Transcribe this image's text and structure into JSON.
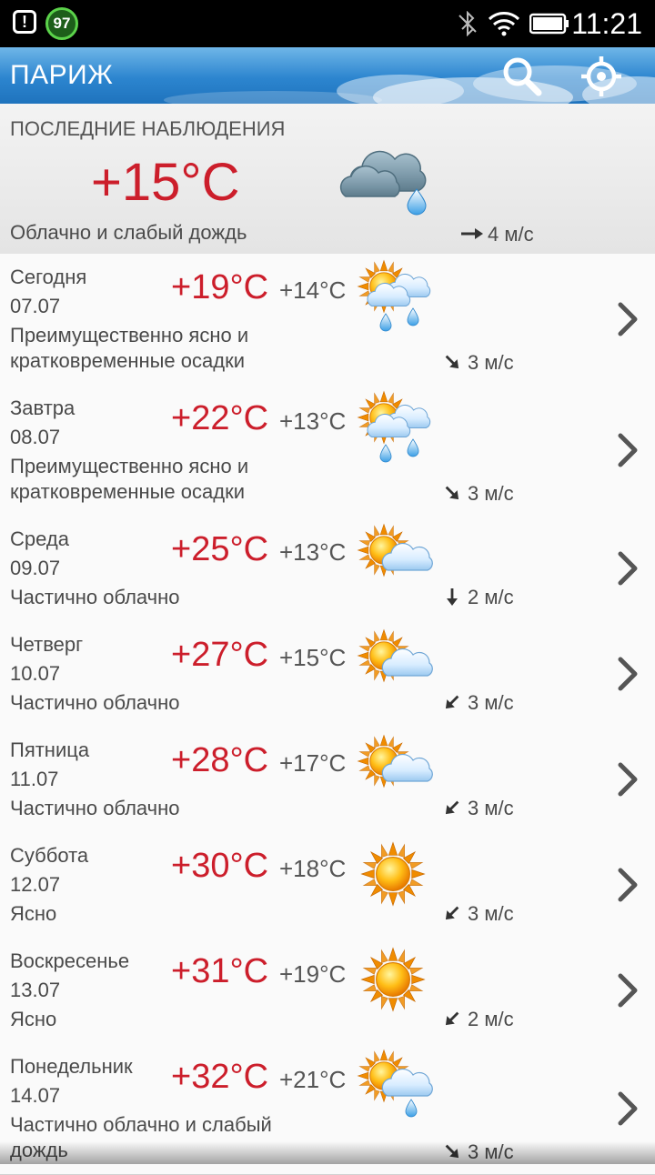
{
  "status": {
    "badge": "97",
    "time": "11:21"
  },
  "app": {
    "title": "ПАРИЖ"
  },
  "current": {
    "heading": "ПОСЛЕДНИЕ НАБЛЮДЕНИЯ",
    "temp": "+15°C",
    "desc": "Облачно и слабый дождь",
    "wind": "4 м/с",
    "icon": "cloud-rain-icon",
    "wind_dir": "east"
  },
  "days": [
    {
      "day": "Сегодня",
      "date": "07.07",
      "hi": "+19°C",
      "lo": "+14°C",
      "desc": "Преимущественно ясно и кратковременные осадки",
      "wind": "3 м/с",
      "icon": "sun-cloud-rain-icon",
      "wind_dir": "southeast"
    },
    {
      "day": "Завтра",
      "date": "08.07",
      "hi": "+22°C",
      "lo": "+13°C",
      "desc": "Преимущественно ясно и кратковременные осадки",
      "wind": "3 м/с",
      "icon": "sun-cloud-rain-icon",
      "wind_dir": "southeast"
    },
    {
      "day": "Среда",
      "date": "09.07",
      "hi": "+25°C",
      "lo": "+13°C",
      "desc": "Частично облачно",
      "wind": "2 м/с",
      "icon": "sun-cloud-icon",
      "wind_dir": "south"
    },
    {
      "day": "Четверг",
      "date": "10.07",
      "hi": "+27°C",
      "lo": "+15°C",
      "desc": "Частично облачно",
      "wind": "3 м/с",
      "icon": "sun-cloud-icon",
      "wind_dir": "southwest"
    },
    {
      "day": "Пятница",
      "date": "11.07",
      "hi": "+28°C",
      "lo": "+17°C",
      "desc": "Частично облачно",
      "wind": "3 м/с",
      "icon": "sun-cloud-icon",
      "wind_dir": "southwest"
    },
    {
      "day": "Суббота",
      "date": "12.07",
      "hi": "+30°C",
      "lo": "+18°C",
      "desc": "Ясно",
      "wind": "3 м/с",
      "icon": "sun-icon",
      "wind_dir": "southwest"
    },
    {
      "day": "Воскресенье",
      "date": "13.07",
      "hi": "+31°C",
      "lo": "+19°C",
      "desc": "Ясно",
      "wind": "2 м/с",
      "icon": "sun-icon",
      "wind_dir": "southwest"
    },
    {
      "day": "Понедельник",
      "date": "14.07",
      "hi": "+32°C",
      "lo": "+21°C",
      "desc": "Частично облачно и слабый дождь",
      "wind": "3 м/с",
      "icon": "sun-cloud-drop-icon",
      "wind_dir": "southeast"
    }
  ]
}
